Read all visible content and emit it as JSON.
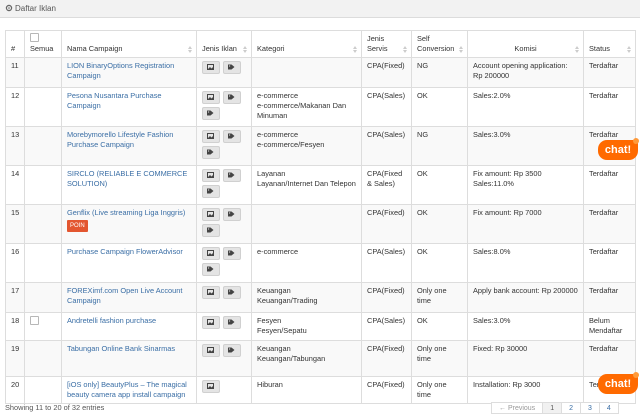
{
  "panel": {
    "title": "Daftar Iklan",
    "icon": "gear-icon"
  },
  "table": {
    "headers": {
      "no": "#",
      "select_all": "Semua",
      "campaign": "Nama Campaign",
      "ad_type": "Jenis Iklan",
      "category": "Kategori",
      "service_type": "Jenis Servis",
      "self_conversion": "Self Conversion",
      "commission": "Komisi",
      "status": "Status"
    },
    "rows": [
      {
        "no": "11",
        "campaign": "LION BinaryOptions Registration Campaign",
        "category_lines": [],
        "service": "CPA(Fixed)",
        "self_conversion": "NG",
        "commission_lines": [
          "Account opening application: Rp 200000"
        ],
        "status": "Terdaftar",
        "checkbox": false,
        "badge": ""
      },
      {
        "no": "12",
        "campaign": "Pesona Nusantara Purchase Campaign",
        "category_lines": [
          "e-commerce",
          "e-commerce/Makanan Dan Minuman"
        ],
        "service": "CPA(Sales)",
        "self_conversion": "OK",
        "commission_lines": [
          "Sales:2.0%"
        ],
        "status": "Terdaftar",
        "checkbox": false,
        "badge": ""
      },
      {
        "no": "13",
        "campaign": "Morebymorello Lifestyle Fashion Purchase Campaign",
        "category_lines": [
          "e-commerce",
          "e-commerce/Fesyen"
        ],
        "service": "CPA(Sales)",
        "self_conversion": "NG",
        "commission_lines": [
          "Sales:3.0%"
        ],
        "status": "Terdaftar",
        "checkbox": false,
        "badge": ""
      },
      {
        "no": "14",
        "campaign": "SIRCLO (RELIABLE E COMMERCE SOLUTION)",
        "category_lines": [
          "Layanan",
          "Layanan/Internet Dan Telepon"
        ],
        "service": "CPA(Fixed & Sales)",
        "self_conversion": "OK",
        "commission_lines": [
          "Fix amount: Rp 3500",
          "Sales:11.0%"
        ],
        "status": "Terdaftar",
        "checkbox": false,
        "badge": ""
      },
      {
        "no": "15",
        "campaign": "Genflix (Live streaming Liga Inggris)",
        "category_lines": [],
        "service": "CPA(Fixed)",
        "self_conversion": "OK",
        "commission_lines": [
          "Fix amount: Rp 7000"
        ],
        "status": "Terdaftar",
        "checkbox": false,
        "badge": "POIN"
      },
      {
        "no": "16",
        "campaign": "Purchase Campaign FlowerAdvisor",
        "category_lines": [
          "e-commerce"
        ],
        "service": "CPA(Sales)",
        "self_conversion": "OK",
        "commission_lines": [
          "Sales:8.0%"
        ],
        "status": "Terdaftar",
        "checkbox": false,
        "badge": ""
      },
      {
        "no": "17",
        "campaign": "FOREXimf.com Open Live Account Campaign",
        "category_lines": [
          "Keuangan",
          "Keuangan/Trading"
        ],
        "service": "CPA(Fixed)",
        "self_conversion": "Only one time",
        "commission_lines": [
          "Apply bank account: Rp 200000"
        ],
        "status": "Terdaftar",
        "checkbox": false,
        "badge": ""
      },
      {
        "no": "18",
        "campaign": "Andretelli fashion purchase",
        "category_lines": [
          "Fesyen",
          "Fesyen/Sepatu"
        ],
        "service": "CPA(Sales)",
        "self_conversion": "OK",
        "commission_lines": [
          "Sales:3.0%"
        ],
        "status": "Belum Mendaftar",
        "checkbox": true,
        "badge": ""
      },
      {
        "no": "19",
        "campaign": "Tabungan Online Bank Sinarmas",
        "category_lines": [
          "Keuangan",
          "Keuangan/Tabungan"
        ],
        "service": "CPA(Fixed)",
        "self_conversion": "Only one time",
        "commission_lines": [
          "Fixed: Rp 30000"
        ],
        "status": "Terdaftar",
        "checkbox": false,
        "badge": ""
      },
      {
        "no": "20",
        "campaign": "[iOS only] BeautyPlus – The magical beauty camera app install campaign",
        "category_lines": [
          "Hiburan"
        ],
        "service": "CPA(Fixed)",
        "self_conversion": "Only one time",
        "commission_lines": [
          "Installation: Rp 3000"
        ],
        "status": "Terdaftar",
        "checkbox": false,
        "badge": ""
      }
    ]
  },
  "chat_label": "chat!",
  "footer": {
    "info": "Showing 11 to 20 of 32 entries",
    "pagination": [
      "← Previous",
      "1",
      "2",
      "3",
      "4"
    ]
  }
}
